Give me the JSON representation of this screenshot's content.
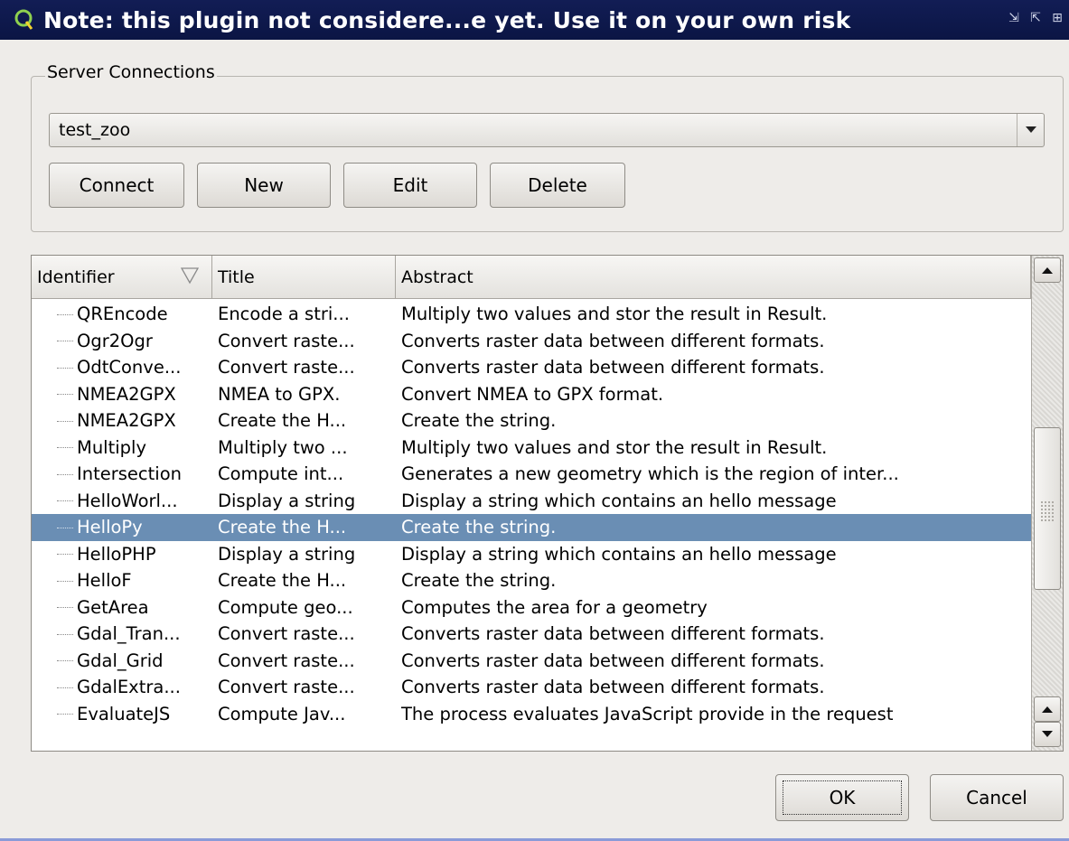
{
  "window": {
    "title": "Note: this plugin not considere...e yet. Use it on your own risk",
    "icon": "qgis-icon",
    "controls": [
      "⇲",
      "⇱",
      "⊞"
    ]
  },
  "server_connections": {
    "legend": "Server Connections",
    "selected": "test_zoo",
    "buttons": {
      "connect": "Connect",
      "new": "New",
      "edit": "Edit",
      "delete": "Delete"
    }
  },
  "table": {
    "headers": [
      "Identifier",
      "Title",
      "Abstract"
    ],
    "rows": [
      {
        "id": "QREncode",
        "title": "Encode a stri...",
        "abstract": "Multiply two values and stor the result in Result."
      },
      {
        "id": "Ogr2Ogr",
        "title": "Convert raste...",
        "abstract": "Converts raster data between different formats."
      },
      {
        "id": "OdtConve...",
        "title": "Convert raste...",
        "abstract": "Converts raster data between different formats."
      },
      {
        "id": "NMEA2GPX",
        "title": "NMEA to GPX.",
        "abstract": "Convert NMEA to GPX format."
      },
      {
        "id": "NMEA2GPX",
        "title": "Create the H...",
        "abstract": "Create the string."
      },
      {
        "id": "Multiply",
        "title": "Multiply two ...",
        "abstract": "Multiply two values and stor the result in Result."
      },
      {
        "id": "Intersection",
        "title": "Compute int...",
        "abstract": "Generates a new geometry which is the region of inter..."
      },
      {
        "id": "HelloWorl...",
        "title": "Display a string",
        "abstract": "Display a string which contains an hello message"
      },
      {
        "id": "HelloPy",
        "title": "Create the H...",
        "abstract": "Create the string.",
        "selected": true
      },
      {
        "id": "HelloPHP",
        "title": "Display a string",
        "abstract": "Display a string which contains an hello message"
      },
      {
        "id": "HelloF",
        "title": "Create the H...",
        "abstract": "Create the string."
      },
      {
        "id": "GetArea",
        "title": "Compute geo...",
        "abstract": "Computes the area for a geometry"
      },
      {
        "id": "Gdal_Tran...",
        "title": "Convert raste...",
        "abstract": "Converts raster data between different formats."
      },
      {
        "id": "Gdal_Grid",
        "title": "Convert raste...",
        "abstract": "Converts raster data between different formats."
      },
      {
        "id": "GdalExtra...",
        "title": "Convert raste...",
        "abstract": "Converts raster data between different formats."
      },
      {
        "id": "EvaluateJS",
        "title": "Compute Jav...",
        "abstract": "The process evaluates JavaScript provide in the request"
      }
    ]
  },
  "dialog_buttons": {
    "ok": "OK",
    "cancel": "Cancel"
  },
  "colors": {
    "titlebar": "#0b1544",
    "selection": "#6a8eb4"
  }
}
